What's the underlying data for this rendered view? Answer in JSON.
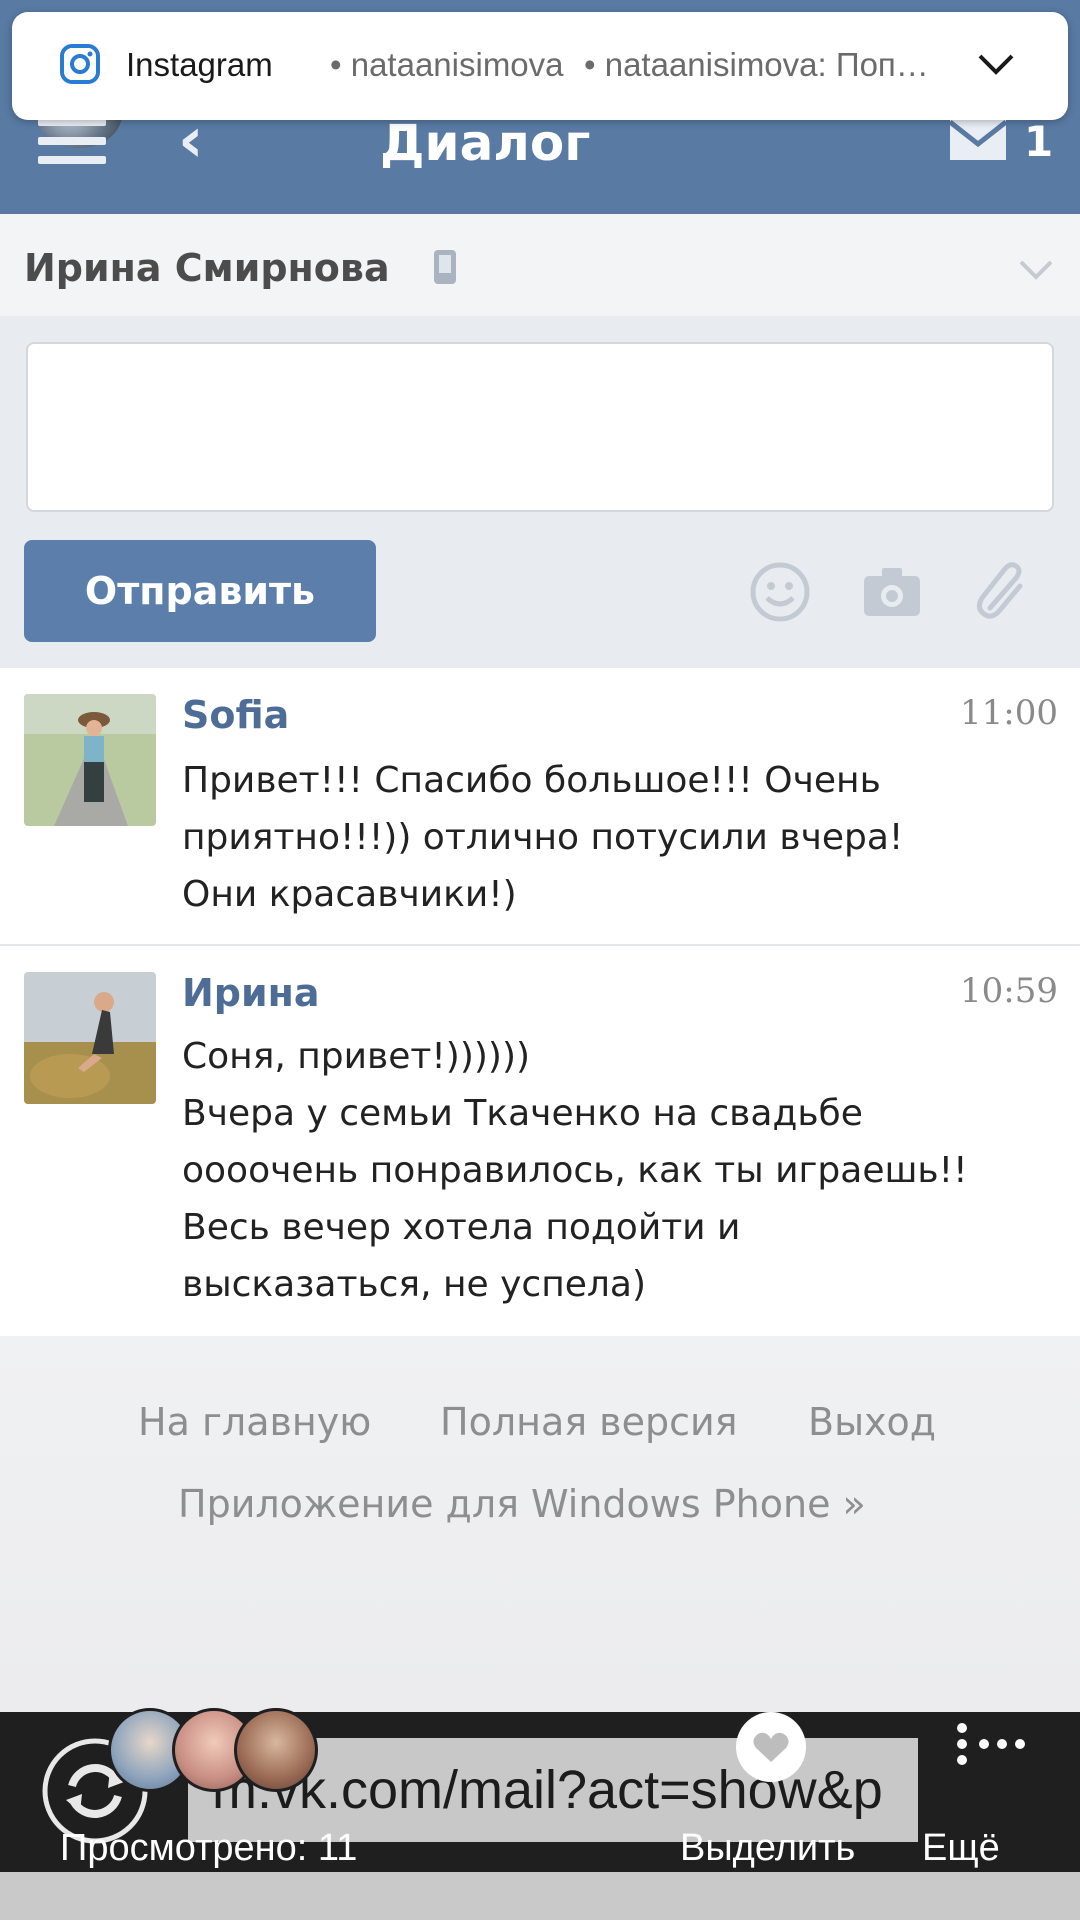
{
  "notification": {
    "app": "Instagram",
    "user": "• nataanisimova",
    "message": "• nataanisimova: Поп…"
  },
  "header": {
    "title": "Диалог",
    "mail_count": "1",
    "colors": {
      "bar": "#587aa3"
    }
  },
  "dialog": {
    "partner_name": "Ирина Смирнова"
  },
  "compose": {
    "placeholder": "",
    "send_label": "Отправить",
    "tools": [
      "smiley-icon",
      "camera-icon",
      "paperclip-icon"
    ]
  },
  "messages": [
    {
      "author": "Sofia",
      "time": "11:00",
      "text": "Привет!!! Спасибо большое!!! Очень\nприятно!!!)) отлично потусили вчера!\nОни красавчики!)"
    },
    {
      "author": "Ирина",
      "time": "10:59",
      "text": "Соня, привет!))))))\nВчера у семьи Ткаченко на свадьбе\nоооочень понравилось, как ты играешь!!\nВесь вечер хотела подойти и\nвысказаться, не успела)"
    }
  ],
  "footer": {
    "home": "На главную",
    "full_version": "Полная версия",
    "logout": "Выход",
    "app_link": "Приложение для Windows Phone »"
  },
  "story": {
    "url": "m.vk.com/mail?act=show&p",
    "viewed": "Просмотрено: 11",
    "highlight": "Выделить",
    "more": "Ещё"
  }
}
